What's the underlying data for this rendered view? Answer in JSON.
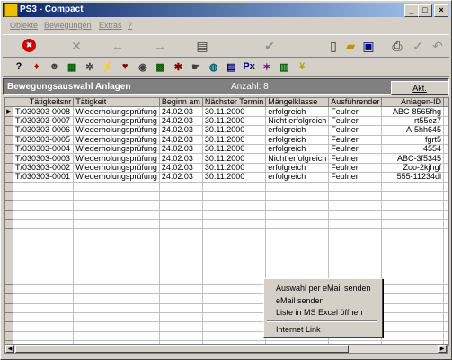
{
  "window": {
    "title": "PS3 - Compact"
  },
  "menu": [
    "Objekte",
    "Bewegungen",
    "Extras",
    "?"
  ],
  "toolbar1": [
    {
      "icon": "stop-icon",
      "glyph": "✖",
      "color": "#ffffff",
      "bg": "#d00000"
    },
    {
      "icon": "cancel-icon",
      "glyph": "✕",
      "color": "#909090"
    },
    {
      "icon": "arrow-left-icon",
      "glyph": "←",
      "color": "#909090"
    },
    {
      "icon": "arrow-right-icon",
      "glyph": "→",
      "color": "#909090"
    },
    {
      "icon": "print-icon",
      "glyph": "▤",
      "color": "#404040"
    },
    {
      "icon": "check-icon",
      "glyph": "✔",
      "color": "#909090"
    },
    {
      "icon": "document-icon",
      "glyph": "▯",
      "color": "#303030"
    },
    {
      "icon": "folder-open-icon",
      "glyph": "▰",
      "color": "#c09000"
    },
    {
      "icon": "window-icon",
      "glyph": "▣",
      "color": "#000080"
    },
    {
      "icon": "printer-icon",
      "glyph": "⎙",
      "color": "#303030"
    },
    {
      "icon": "edit-check-icon",
      "glyph": "✓",
      "color": "#909090"
    },
    {
      "icon": "undo-icon",
      "glyph": "↶",
      "color": "#909090"
    }
  ],
  "toolbar2": [
    {
      "icon": "help-icon",
      "glyph": "?",
      "color": "#000000"
    },
    {
      "icon": "users-icon",
      "glyph": "♦",
      "color": "#c00000"
    },
    {
      "icon": "person-icon",
      "glyph": "☻",
      "color": "#404040"
    },
    {
      "icon": "table-icon",
      "glyph": "▦",
      "color": "#006000"
    },
    {
      "icon": "gear-icon",
      "glyph": "✲",
      "color": "#404040"
    },
    {
      "icon": "wand-icon",
      "glyph": "⚡",
      "color": "#c0a000"
    },
    {
      "icon": "heart-icon",
      "glyph": "♥",
      "color": "#800000"
    },
    {
      "icon": "eye-icon",
      "glyph": "◉",
      "color": "#404040"
    },
    {
      "icon": "grid-icon",
      "glyph": "▩",
      "color": "#006000"
    },
    {
      "icon": "tool-icon",
      "glyph": "✱",
      "color": "#800000"
    },
    {
      "icon": "hand-icon",
      "glyph": "☛",
      "color": "#404040"
    },
    {
      "icon": "globe-icon",
      "glyph": "◍",
      "color": "#006080"
    },
    {
      "icon": "chart-icon",
      "glyph": "▤",
      "color": "#000080"
    },
    {
      "icon": "badge-icon",
      "glyph": "Px",
      "color": "#000080"
    },
    {
      "icon": "settings-icon",
      "glyph": "✶",
      "color": "#800080"
    },
    {
      "icon": "list-icon",
      "glyph": "▥",
      "color": "#006000"
    },
    {
      "icon": "bulb-icon",
      "glyph": "¥",
      "color": "#c0a000"
    }
  ],
  "header": {
    "title": "Bewegungsauswahl Anlagen",
    "count": "Anzahl: 8",
    "button": "Akt."
  },
  "table": {
    "columns": [
      "Tätigkeitsnr",
      "Tätigkeit",
      "Beginn am",
      "Nächster Termin",
      "Mängelklasse",
      "Ausführender",
      "Anlagen-ID"
    ],
    "rows": [
      [
        "T/030303-0008",
        "Wiederholungsprüfung",
        "24.02.03",
        "30.11.2000",
        "erfolgreich",
        "Feulner",
        "ABC-8565fhg"
      ],
      [
        "T/030303-0007",
        "Wiederholungsprüfung",
        "24.02.03",
        "30.11.2000",
        "Nicht erfolgreich",
        "Feulner",
        "rt55ez7"
      ],
      [
        "T/030303-0006",
        "Wiederholungsprüfung",
        "24.02.03",
        "30.11.2000",
        "erfolgreich",
        "Feulner",
        "A-5hh645"
      ],
      [
        "T/030303-0005",
        "Wiederholungsprüfung",
        "24.02.03",
        "30.11.2000",
        "erfolgreich",
        "Feulner",
        "fgrt5"
      ],
      [
        "T/030303-0004",
        "Wiederholungsprüfung",
        "24.02.03",
        "30.11.2000",
        "erfolgreich",
        "Feulner",
        "4554"
      ],
      [
        "T/030303-0003",
        "Wiederholungsprüfung",
        "24.02.03",
        "30.11.2000",
        "Nicht erfolgreich",
        "Feulner",
        "ABC-3f5345"
      ],
      [
        "T/030303-0002",
        "Wiederholungsprüfung",
        "24.02.03",
        "30.11.2000",
        "erfolgreich",
        "Feulner",
        "Zoo-2kjhgf"
      ],
      [
        "T/030303-0001",
        "Wiederholungsprüfung",
        "24.02.03",
        "30.11.2000",
        "erfolgreich",
        "Feulner",
        "555-11234dl"
      ]
    ],
    "selected_row_marker": "▶"
  },
  "context_menu": [
    "Auswahl per eMail senden",
    "eMail senden",
    "Liste in MS Excel öffnen",
    "Internet Link"
  ]
}
